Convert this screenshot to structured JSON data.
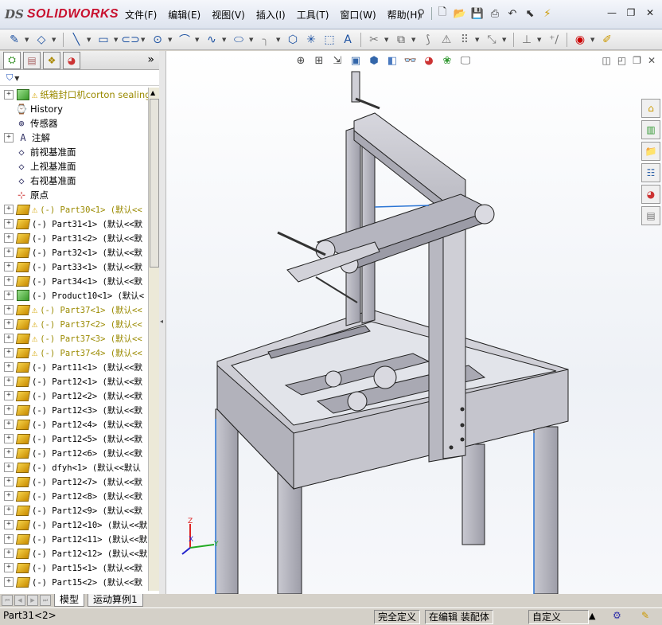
{
  "app": {
    "brand_prefix": "DS",
    "brand_name": "SOLIDWORKS"
  },
  "menu": [
    "文件(F)",
    "编辑(E)",
    "视图(V)",
    "插入(I)",
    "工具(T)",
    "窗口(W)",
    "帮助(H)"
  ],
  "panel": {
    "filter_label": "▼"
  },
  "tree": [
    {
      "label": "纸箱封口机corton sealing",
      "icon": "assembly-icon",
      "expand": "+",
      "warn": true,
      "root": true
    },
    {
      "label": "History",
      "icon": "history-icon",
      "expand": ""
    },
    {
      "label": "传感器",
      "icon": "sensor-icon",
      "expand": ""
    },
    {
      "label": "注解",
      "icon": "annotation-icon",
      "expand": "+"
    },
    {
      "label": "前视基准面",
      "icon": "plane-icon",
      "expand": ""
    },
    {
      "label": "上视基准面",
      "icon": "plane-icon",
      "expand": ""
    },
    {
      "label": "右视基准面",
      "icon": "plane-icon",
      "expand": ""
    },
    {
      "label": "原点",
      "icon": "origin-icon",
      "expand": ""
    },
    {
      "label": "(-) Part30<1> (默认<<",
      "icon": "part-icon",
      "expand": "+",
      "warn": true
    },
    {
      "label": "(-) Part31<1> (默认<<默",
      "icon": "part-icon",
      "expand": "+"
    },
    {
      "label": "(-) Part31<2> (默认<<默",
      "icon": "part-icon",
      "expand": "+"
    },
    {
      "label": "(-) Part32<1> (默认<<默",
      "icon": "part-icon",
      "expand": "+"
    },
    {
      "label": "(-) Part33<1> (默认<<默",
      "icon": "part-icon",
      "expand": "+"
    },
    {
      "label": "(-) Part34<1> (默认<<默",
      "icon": "part-icon",
      "expand": "+"
    },
    {
      "label": "(-) Product10<1> (默认<",
      "icon": "subassembly-icon",
      "expand": "+"
    },
    {
      "label": "(-) Part37<1> (默认<<",
      "icon": "part-icon",
      "expand": "+",
      "warn": true
    },
    {
      "label": "(-) Part37<2> (默认<<",
      "icon": "part-icon",
      "expand": "+",
      "warn": true
    },
    {
      "label": "(-) Part37<3> (默认<<",
      "icon": "part-icon",
      "expand": "+",
      "warn": true
    },
    {
      "label": "(-) Part37<4> (默认<<",
      "icon": "part-icon",
      "expand": "+",
      "warn": true
    },
    {
      "label": "(-) Part11<1> (默认<<默",
      "icon": "part-icon",
      "expand": "+"
    },
    {
      "label": "(-) Part12<1> (默认<<默",
      "icon": "part-icon",
      "expand": "+"
    },
    {
      "label": "(-) Part12<2> (默认<<默",
      "icon": "part-icon",
      "expand": "+"
    },
    {
      "label": "(-) Part12<3> (默认<<默",
      "icon": "part-icon",
      "expand": "+"
    },
    {
      "label": "(-) Part12<4> (默认<<默",
      "icon": "part-icon",
      "expand": "+"
    },
    {
      "label": "(-) Part12<5> (默认<<默",
      "icon": "part-icon",
      "expand": "+"
    },
    {
      "label": "(-) Part12<6> (默认<<默",
      "icon": "part-icon",
      "expand": "+"
    },
    {
      "label": "(-) dfyh<1> (默认<<默认",
      "icon": "part-icon",
      "expand": "+"
    },
    {
      "label": "(-) Part12<7> (默认<<默",
      "icon": "part-icon",
      "expand": "+"
    },
    {
      "label": "(-) Part12<8> (默认<<默",
      "icon": "part-icon",
      "expand": "+"
    },
    {
      "label": "(-) Part12<9> (默认<<默",
      "icon": "part-icon",
      "expand": "+"
    },
    {
      "label": "(-) Part12<10> (默认<<默",
      "icon": "part-icon",
      "expand": "+"
    },
    {
      "label": "(-) Part12<11> (默认<<默",
      "icon": "part-icon",
      "expand": "+"
    },
    {
      "label": "(-) Part12<12> (默认<<默",
      "icon": "part-icon",
      "expand": "+"
    },
    {
      "label": "(-) Part15<1> (默认<<默",
      "icon": "part-icon",
      "expand": "+"
    },
    {
      "label": "(-) Part15<2> (默认<<默",
      "icon": "part-icon",
      "expand": "+"
    }
  ],
  "axes": {
    "x": "X",
    "y": "Y",
    "z": "Z"
  },
  "bottom_tabs": [
    "模型",
    "运动算例1"
  ],
  "status": {
    "selection": "Part31<2>",
    "definition": "完全定义",
    "mode": "在编辑 装配体",
    "custom": "自定义"
  },
  "colors": {
    "warning_text": "#9a8a00",
    "brand_red": "#c8102e",
    "model_gray": "#bcbcc4"
  }
}
